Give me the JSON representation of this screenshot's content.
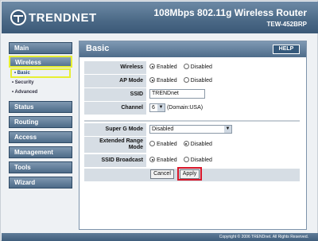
{
  "header": {
    "logo_text": "TRENDNET",
    "product_title": "108Mbps 802.11g Wireless Router",
    "model": "TEW-452BRP"
  },
  "sidebar": {
    "items": [
      {
        "label": "Main"
      },
      {
        "label": "Wireless"
      },
      {
        "label": "Status"
      },
      {
        "label": "Routing"
      },
      {
        "label": "Access"
      },
      {
        "label": "Management"
      },
      {
        "label": "Tools"
      },
      {
        "label": "Wizard"
      }
    ],
    "subitems": [
      {
        "label": "• Basic"
      },
      {
        "label": "• Security"
      },
      {
        "label": "• Advanced"
      }
    ]
  },
  "content": {
    "title": "Basic",
    "help_label": "HELP",
    "wireless": {
      "label": "Wireless",
      "options": [
        "Enabled",
        "Disabled"
      ],
      "selected": "Enabled"
    },
    "ap_mode": {
      "label": "AP Mode",
      "options": [
        "Enabled",
        "Disabled"
      ],
      "selected": "Enabled"
    },
    "ssid": {
      "label": "SSID",
      "value": "TRENDnet"
    },
    "channel": {
      "label": "Channel",
      "value": "6",
      "note": "(Domain:USA)"
    },
    "super_g": {
      "label": "Super G Mode",
      "value": "Disabled"
    },
    "extended_range": {
      "label": "Extended Range Mode",
      "options": [
        "Enabled",
        "Disabled"
      ],
      "selected": "Disabled"
    },
    "ssid_broadcast": {
      "label": "SSID Broadcast",
      "options": [
        "Enabled",
        "Disabled"
      ],
      "selected": "Enabled"
    },
    "cancel_label": "Cancel",
    "apply_label": "Apply"
  },
  "footer": {
    "copyright": "Copyright © 2006 TRENDnet. All Rights Reserved."
  },
  "colors": {
    "header_blue": "#4b6986",
    "highlight_yellow": "#e7ef32",
    "highlight_red": "#d9162a"
  }
}
